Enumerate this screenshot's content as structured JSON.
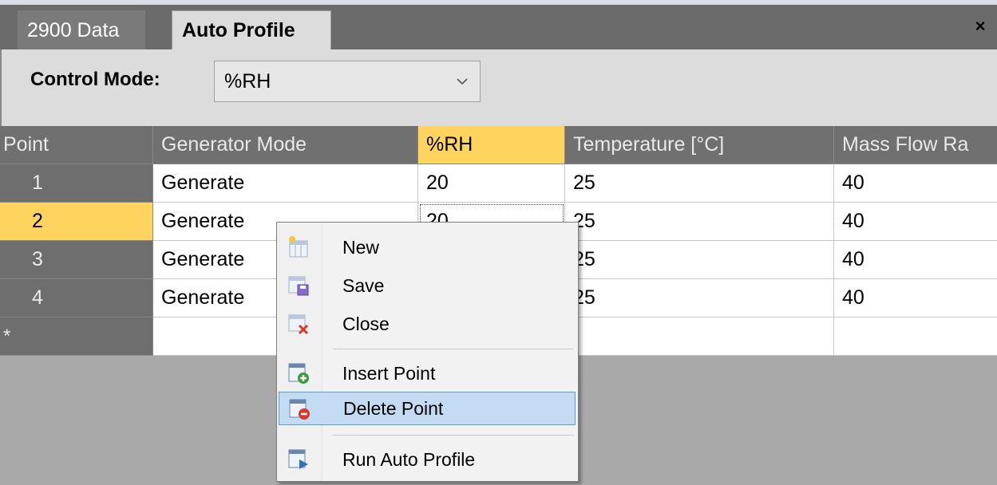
{
  "tabs": [
    {
      "label": "2900 Data",
      "active": false
    },
    {
      "label": "Auto Profile",
      "active": true
    }
  ],
  "close_glyph": "×",
  "control_mode": {
    "label": "Control Mode:",
    "value": "%RH"
  },
  "grid": {
    "columns": [
      "Point",
      "Generator Mode",
      "%RH",
      "Temperature [°C]",
      "Mass Flow Ra"
    ],
    "rows": [
      {
        "point": "1",
        "generator_mode": "Generate",
        "rh": "20",
        "temperature": "25",
        "mass_flow": "40"
      },
      {
        "point": "2",
        "generator_mode": "Generate",
        "rh": "20",
        "temperature": "25",
        "mass_flow": "40"
      },
      {
        "point": "3",
        "generator_mode": "Generate",
        "rh": "",
        "temperature": "25",
        "mass_flow": "40"
      },
      {
        "point": "4",
        "generator_mode": "Generate",
        "rh": "",
        "temperature": "25",
        "mass_flow": "40"
      }
    ],
    "new_row_marker": "*",
    "selected_column": "%RH",
    "current_row": "2"
  },
  "context_menu": {
    "items": [
      {
        "label": "New",
        "icon": "new-icon"
      },
      {
        "label": "Save",
        "icon": "save-icon"
      },
      {
        "label": "Close",
        "icon": "close-icon"
      },
      {
        "label": "Insert Point",
        "icon": "insert-point-icon"
      },
      {
        "label": "Delete Point",
        "icon": "delete-point-icon",
        "highlighted": true
      },
      {
        "label": "Run Auto Profile",
        "icon": "run-auto-profile-icon"
      }
    ]
  },
  "colors": {
    "accent_yellow": "#ffd45e",
    "menu_highlight": "#c3dcf3",
    "menu_highlight_border": "#5a9ad8"
  }
}
